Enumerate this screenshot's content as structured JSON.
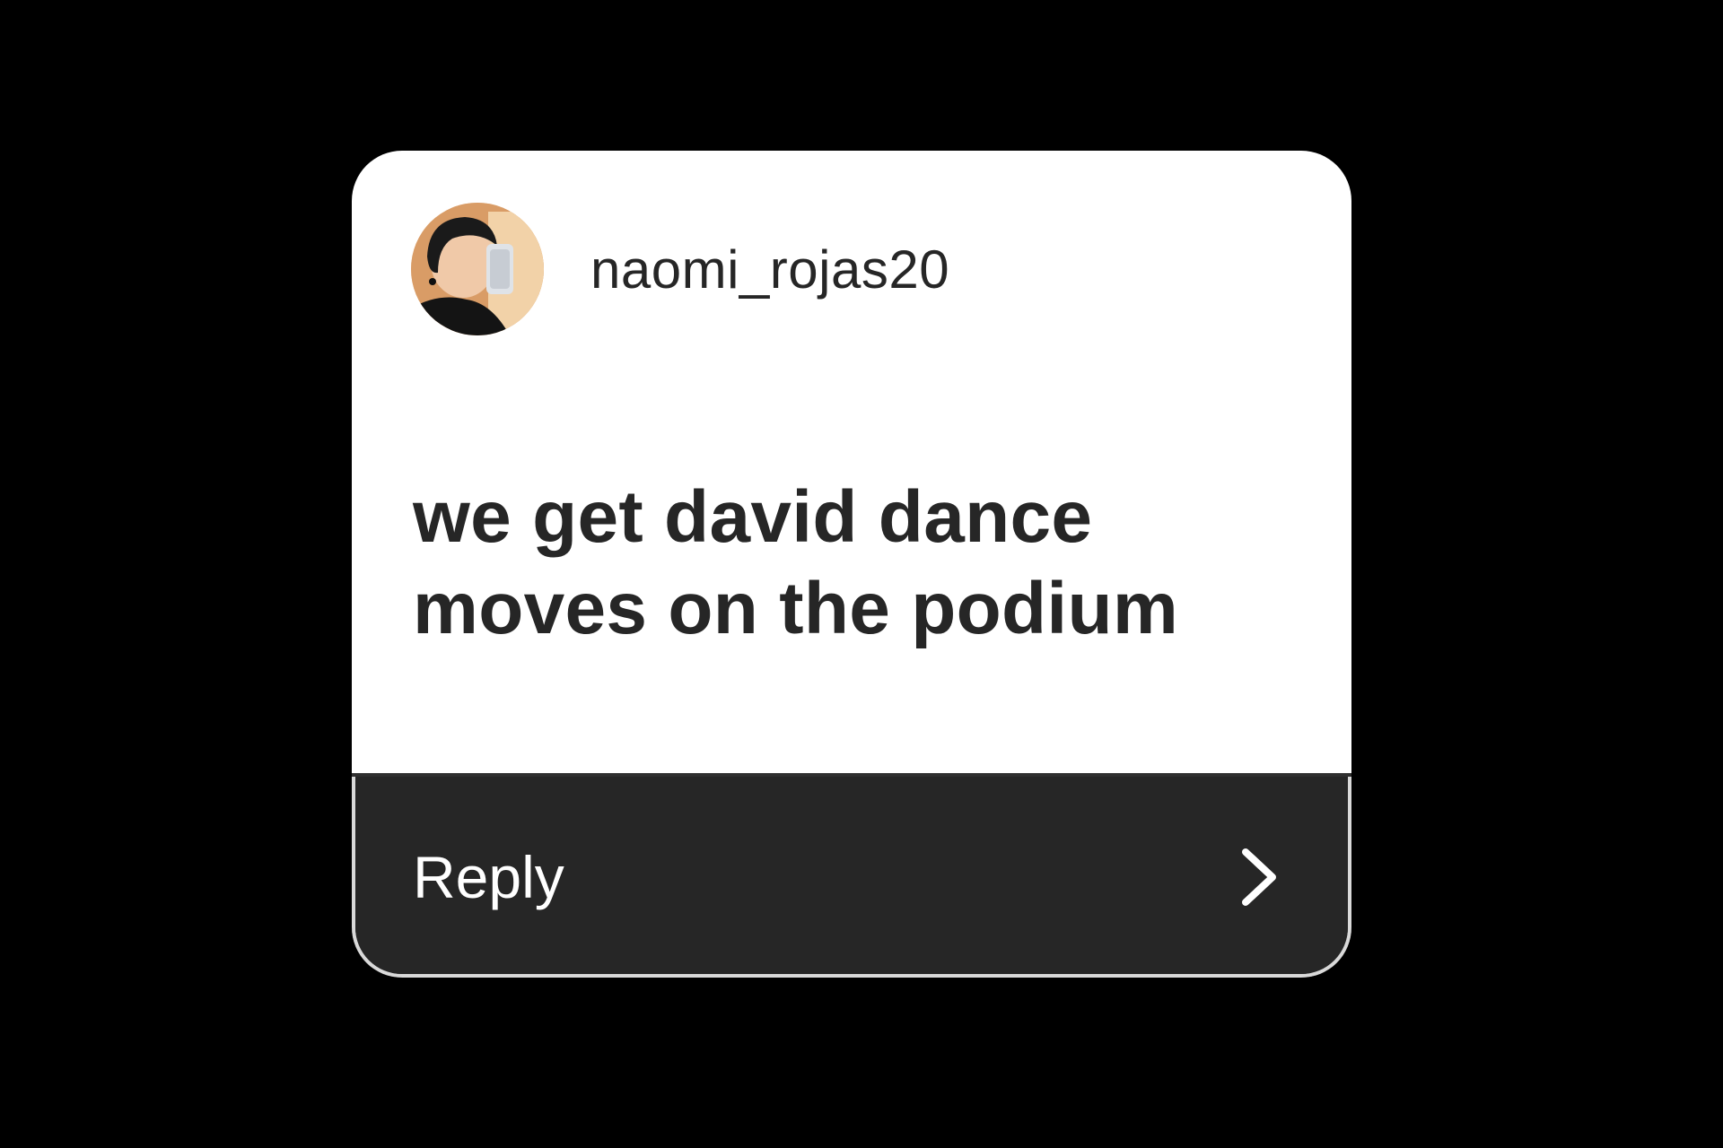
{
  "story_reply_card": {
    "username": "naomi_rojas20",
    "message": "we get david dance moves on the podium",
    "reply_label": "Reply",
    "avatar_icon": "profile-photo",
    "chevron_icon": "chevron-right-icon"
  },
  "colors": {
    "background": "#000000",
    "card": "#ffffff",
    "text": "#262626",
    "reply_bar": "#262626",
    "reply_text": "#ffffff"
  }
}
